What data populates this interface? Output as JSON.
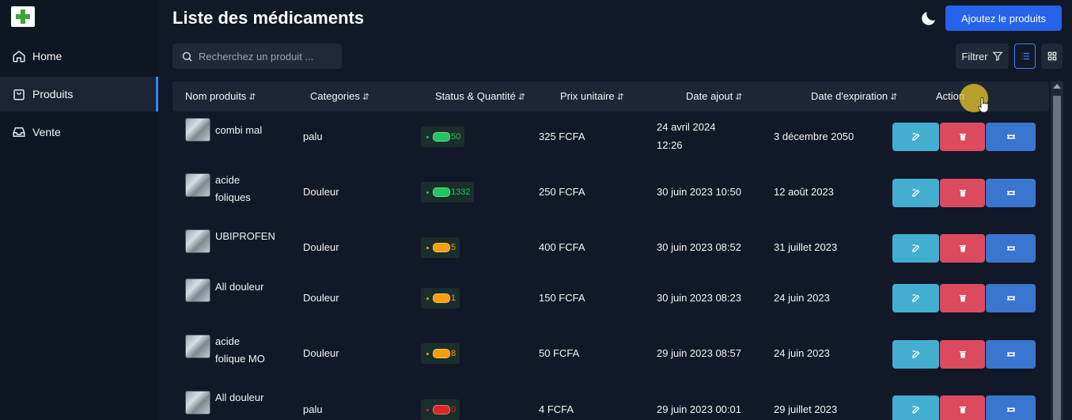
{
  "sidebar": {
    "items": [
      {
        "label": "Home",
        "icon": "home-icon"
      },
      {
        "label": "Produits",
        "icon": "bag-icon"
      },
      {
        "label": "Vente",
        "icon": "inbox-icon"
      }
    ]
  },
  "header": {
    "title": "Liste des médicaments",
    "add_button": "Ajoutez le produits"
  },
  "toolbar": {
    "search_placeholder": "Recherchez un produit ...",
    "filter_label": "Filtrer"
  },
  "table": {
    "columns": [
      "Nom produits",
      "Categories",
      "Status & Quantité",
      "Prix unitaire",
      "Date ajout",
      "Date d'expiration",
      "Action"
    ],
    "sort_glyph": "⇵",
    "rows": [
      {
        "name1": "combi mal",
        "name2": "",
        "category": "palu",
        "quantity": "50",
        "status_color": "#22c55e",
        "price": "325 FCFA",
        "added1": "24 avril 2024",
        "added2": "12:26",
        "expiry": "3 décembre 2050"
      },
      {
        "name1": "acide",
        "name2": "foliques",
        "category": "Douleur",
        "quantity": "1332",
        "status_color": "#22c55e",
        "price": "250 FCFA",
        "added1": "30 juin 2023 10:50",
        "added2": "",
        "expiry": "12 août 2023"
      },
      {
        "name1": "UBIPROFEN",
        "name2": "",
        "category": "Douleur",
        "quantity": "5",
        "status_color": "#f59e0b",
        "price": "400 FCFA",
        "added1": "30 juin 2023 08:52",
        "added2": "",
        "expiry": "31 juillet 2023"
      },
      {
        "name1": "All douleur",
        "name2": "",
        "category": "Douleur",
        "quantity": "1",
        "status_color": "#f59e0b",
        "price": "150 FCFA",
        "added1": "30 juin 2023 08:23",
        "added2": "",
        "expiry": "24 juin 2023"
      },
      {
        "name1": "acide",
        "name2": "folique MO",
        "category": "Douleur",
        "quantity": "8",
        "status_color": "#f59e0b",
        "price": "50 FCFA",
        "added1": "29 juin 2023 08:57",
        "added2": "",
        "expiry": "24 juin 2023"
      },
      {
        "name1": "All douleur",
        "name2": "",
        "category": "palu",
        "quantity": "0",
        "status_color": "#dc2626",
        "price": "4 FCFA",
        "added1": "29 juin 2023 00:01",
        "added2": "",
        "expiry": "29 juillet 2023"
      }
    ]
  },
  "colors": {
    "background": "#111827",
    "sidebar": "#0f1623",
    "accent": "#2563eb",
    "edit": "#44aed1",
    "delete": "#dc4a5f",
    "sell": "#3a75cf"
  }
}
